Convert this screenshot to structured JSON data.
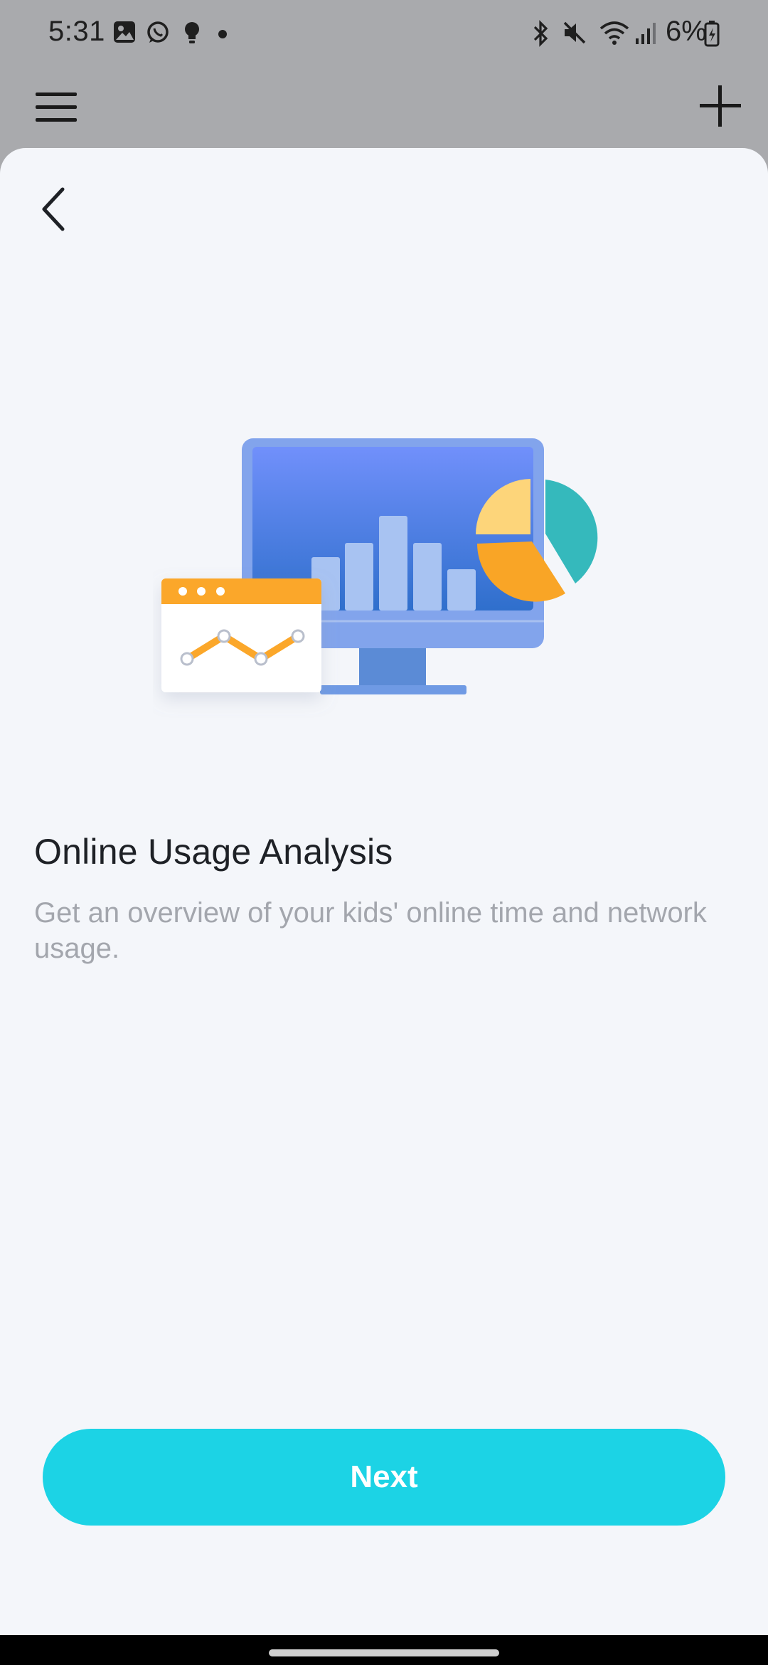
{
  "status_bar": {
    "time": "5:31",
    "battery": "6%",
    "left_icons": [
      "gallery-icon",
      "whatsapp-icon",
      "bulb-icon",
      "dot-icon"
    ],
    "right_icons": [
      "bluetooth-icon",
      "mute-icon",
      "wifi-icon",
      "signal-icon",
      "battery-icon"
    ]
  },
  "top_bar": {
    "menu_icon": "hamburger-menu-icon",
    "add_icon": "plus-icon"
  },
  "sheet": {
    "back_icon": "chevron-left-icon",
    "illustration": "monitor-charts-illustration",
    "title": "Online Usage Analysis",
    "description": "Get an overview of your kids' online time and network usage.",
    "next_label": "Next"
  },
  "colors": {
    "accent": "#1cd3e5",
    "sheet_bg": "#f4f6fa",
    "title": "#1e2126",
    "description": "#a3a6ad"
  }
}
